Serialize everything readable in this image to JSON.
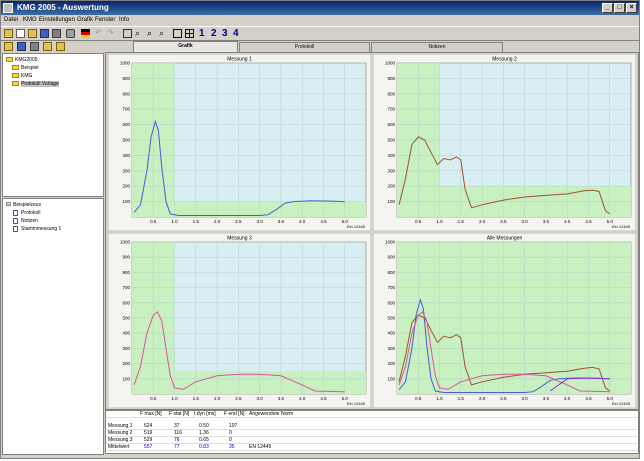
{
  "window": {
    "title": "KMG 2005 - Auswertung"
  },
  "menu": [
    "Datei",
    "KMG",
    "Einstellungen",
    "Grafik",
    "Fenster",
    "Info"
  ],
  "toolbar": {
    "page_buttons": [
      "1",
      "2",
      "3",
      "4"
    ]
  },
  "tree": {
    "nodes": [
      {
        "label": "KMG2005",
        "level": 0,
        "icon": "folder-icon"
      },
      {
        "label": "Beispiel",
        "level": 1,
        "icon": "folder-icon"
      },
      {
        "label": "KMG",
        "level": 1,
        "icon": "folder-icon"
      },
      {
        "label": "Protokoll Vorlage",
        "level": 1,
        "icon": "folder-icon",
        "selected": true
      }
    ]
  },
  "tree2": {
    "nodes": [
      {
        "label": "Beispielzeus",
        "level": 0,
        "icon": "minus-box-icon"
      },
      {
        "label": "Protokoll",
        "level": 1,
        "icon": "doc-icon"
      },
      {
        "label": "Notizen",
        "level": 1,
        "icon": "doc-icon"
      },
      {
        "label": "Stammmessung 1",
        "level": 1,
        "icon": "doc-icon"
      }
    ]
  },
  "tabs": [
    {
      "label": "Grafik",
      "active": true
    },
    {
      "label": "Protokoll",
      "active": false
    },
    {
      "label": "Notizen",
      "active": false
    }
  ],
  "chart_data": [
    {
      "type": "line",
      "title": "Messung 1",
      "xlabel": "Ein 12445",
      "xlim": [
        0,
        5.5
      ],
      "ylim": [
        0,
        1000
      ],
      "x_ticks": [
        0.5,
        1.0,
        1.5,
        2.0,
        2.5,
        3.0,
        3.5,
        4.0,
        4.5,
        5.0
      ],
      "y_ticks": [
        100,
        200,
        300,
        400,
        500,
        600,
        700,
        800,
        900,
        1000
      ],
      "band": {
        "x_end": 1.0,
        "y_top": 100
      },
      "series": [
        {
          "color": "#4a5bd6",
          "points": [
            [
              0.05,
              30
            ],
            [
              0.2,
              80
            ],
            [
              0.35,
              300
            ],
            [
              0.45,
              520
            ],
            [
              0.55,
              620
            ],
            [
              0.62,
              560
            ],
            [
              0.7,
              320
            ],
            [
              0.8,
              100
            ],
            [
              0.9,
              20
            ],
            [
              1.1,
              10
            ],
            [
              3.0,
              10
            ],
            [
              3.2,
              15
            ],
            [
              3.4,
              50
            ],
            [
              3.6,
              90
            ],
            [
              3.8,
              100
            ],
            [
              4.2,
              105
            ],
            [
              4.7,
              103
            ],
            [
              5.0,
              100
            ]
          ]
        }
      ]
    },
    {
      "type": "line",
      "title": "Messung 2",
      "xlabel": "Ein 12445",
      "xlim": [
        0,
        5.5
      ],
      "ylim": [
        0,
        1000
      ],
      "x_ticks": [
        0.5,
        1.0,
        1.5,
        2.0,
        2.5,
        3.0,
        3.5,
        4.0,
        4.5,
        5.0
      ],
      "y_ticks": [
        100,
        200,
        300,
        400,
        500,
        600,
        700,
        800,
        900,
        1000
      ],
      "band": {
        "x_end": 1.0,
        "y_top": 200
      },
      "series": [
        {
          "color": "#a0522d",
          "points": [
            [
              0.05,
              80
            ],
            [
              0.2,
              250
            ],
            [
              0.35,
              470
            ],
            [
              0.5,
              520
            ],
            [
              0.65,
              500
            ],
            [
              0.8,
              420
            ],
            [
              0.95,
              340
            ],
            [
              1.1,
              380
            ],
            [
              1.25,
              370
            ],
            [
              1.4,
              390
            ],
            [
              1.5,
              370
            ],
            [
              1.6,
              180
            ],
            [
              1.75,
              60
            ],
            [
              2.0,
              80
            ],
            [
              2.5,
              110
            ],
            [
              3.0,
              130
            ],
            [
              3.5,
              140
            ],
            [
              4.0,
              150
            ],
            [
              4.4,
              170
            ],
            [
              4.6,
              175
            ],
            [
              4.75,
              165
            ],
            [
              4.9,
              40
            ],
            [
              5.0,
              20
            ]
          ]
        }
      ]
    },
    {
      "type": "line",
      "title": "Messung 3",
      "xlabel": "Ein 12445",
      "xlim": [
        0,
        5.5
      ],
      "ylim": [
        0,
        1000
      ],
      "x_ticks": [
        0.5,
        1.0,
        1.5,
        2.0,
        2.5,
        3.0,
        3.5,
        4.0,
        4.5,
        5.0
      ],
      "y_ticks": [
        100,
        200,
        300,
        400,
        500,
        600,
        700,
        800,
        900,
        1000
      ],
      "band": {
        "x_end": 1.0,
        "y_top": 150
      },
      "series": [
        {
          "color": "#d9559a",
          "points": [
            [
              0.05,
              60
            ],
            [
              0.2,
              180
            ],
            [
              0.35,
              400
            ],
            [
              0.5,
              520
            ],
            [
              0.6,
              540
            ],
            [
              0.7,
              480
            ],
            [
              0.8,
              300
            ],
            [
              0.9,
              120
            ],
            [
              1.0,
              40
            ],
            [
              1.2,
              30
            ],
            [
              1.5,
              80
            ],
            [
              2.0,
              120
            ],
            [
              2.5,
              130
            ],
            [
              3.0,
              130
            ],
            [
              3.5,
              120
            ],
            [
              4.0,
              60
            ],
            [
              4.3,
              20
            ],
            [
              5.0,
              15
            ]
          ]
        }
      ]
    },
    {
      "type": "line",
      "title": "Alle Messungen",
      "xlabel": "Ein 12445",
      "xlim": [
        0,
        5.5
      ],
      "ylim": [
        0,
        1000
      ],
      "x_ticks": [
        0.5,
        1.0,
        1.5,
        2.0,
        2.5,
        3.0,
        3.5,
        4.0,
        4.5,
        5.0
      ],
      "y_ticks": [
        100,
        200,
        300,
        400,
        500,
        600,
        700,
        800,
        900,
        1000
      ],
      "band": {
        "x_end": 5.0,
        "y_top": 1000
      },
      "series": [
        {
          "color": "#4a5bd6",
          "points": [
            [
              0.05,
              30
            ],
            [
              0.2,
              80
            ],
            [
              0.35,
              300
            ],
            [
              0.45,
              520
            ],
            [
              0.55,
              620
            ],
            [
              0.62,
              560
            ],
            [
              0.7,
              320
            ],
            [
              0.8,
              100
            ],
            [
              0.9,
              20
            ],
            [
              1.1,
              10
            ],
            [
              3.0,
              10
            ],
            [
              3.2,
              15
            ],
            [
              3.4,
              50
            ],
            [
              3.6,
              90
            ],
            [
              3.8,
              100
            ],
            [
              4.2,
              105
            ],
            [
              4.7,
              103
            ],
            [
              5.0,
              100
            ]
          ]
        },
        {
          "color": "#a0522d",
          "points": [
            [
              0.05,
              80
            ],
            [
              0.2,
              250
            ],
            [
              0.35,
              470
            ],
            [
              0.5,
              520
            ],
            [
              0.65,
              500
            ],
            [
              0.8,
              420
            ],
            [
              0.95,
              340
            ],
            [
              1.1,
              380
            ],
            [
              1.25,
              370
            ],
            [
              1.4,
              390
            ],
            [
              1.5,
              370
            ],
            [
              1.6,
              180
            ],
            [
              1.75,
              60
            ],
            [
              2.0,
              80
            ],
            [
              2.5,
              110
            ],
            [
              3.0,
              130
            ],
            [
              3.5,
              140
            ],
            [
              4.0,
              150
            ],
            [
              4.4,
              170
            ],
            [
              4.6,
              175
            ],
            [
              4.75,
              165
            ],
            [
              4.9,
              40
            ],
            [
              5.0,
              20
            ]
          ]
        },
        {
          "color": "#d9559a",
          "points": [
            [
              0.05,
              60
            ],
            [
              0.2,
              180
            ],
            [
              0.35,
              400
            ],
            [
              0.5,
              520
            ],
            [
              0.6,
              540
            ],
            [
              0.7,
              480
            ],
            [
              0.8,
              300
            ],
            [
              0.9,
              120
            ],
            [
              1.0,
              40
            ],
            [
              1.2,
              30
            ],
            [
              1.5,
              80
            ],
            [
              2.0,
              120
            ],
            [
              2.5,
              130
            ],
            [
              3.0,
              130
            ],
            [
              3.5,
              120
            ],
            [
              4.0,
              60
            ],
            [
              4.3,
              20
            ],
            [
              5.0,
              15
            ]
          ]
        },
        {
          "color": "#8a2be2",
          "points": [
            [
              3.6,
              20
            ],
            [
              3.8,
              60
            ],
            [
              4.0,
              100
            ],
            [
              4.5,
              105
            ],
            [
              5.0,
              100
            ]
          ]
        }
      ]
    }
  ],
  "table": {
    "headers": [
      "F max [N]",
      "F stat [N]",
      "t dyn [ms]",
      "F end [N]",
      "Angewendete Norm"
    ],
    "rows": [
      {
        "label": "Messung 1",
        "cells": [
          "624",
          "37",
          "0.50",
          "107",
          ""
        ]
      },
      {
        "label": "Messung 2",
        "cells": [
          "519",
          "116",
          "1.36",
          "0",
          ""
        ]
      },
      {
        "label": "Messung 3",
        "cells": [
          "529",
          "76",
          "0.65",
          "0",
          ""
        ]
      },
      {
        "label": "Mittelwert",
        "cells": [
          "557",
          "77",
          "0.83",
          "35",
          "EN 12445"
        ]
      }
    ]
  },
  "colors": {
    "plot_bg": "#d8eef2",
    "band": "#c8f0c0",
    "grid": "#aacccc",
    "titlebar": "#0a246a"
  }
}
